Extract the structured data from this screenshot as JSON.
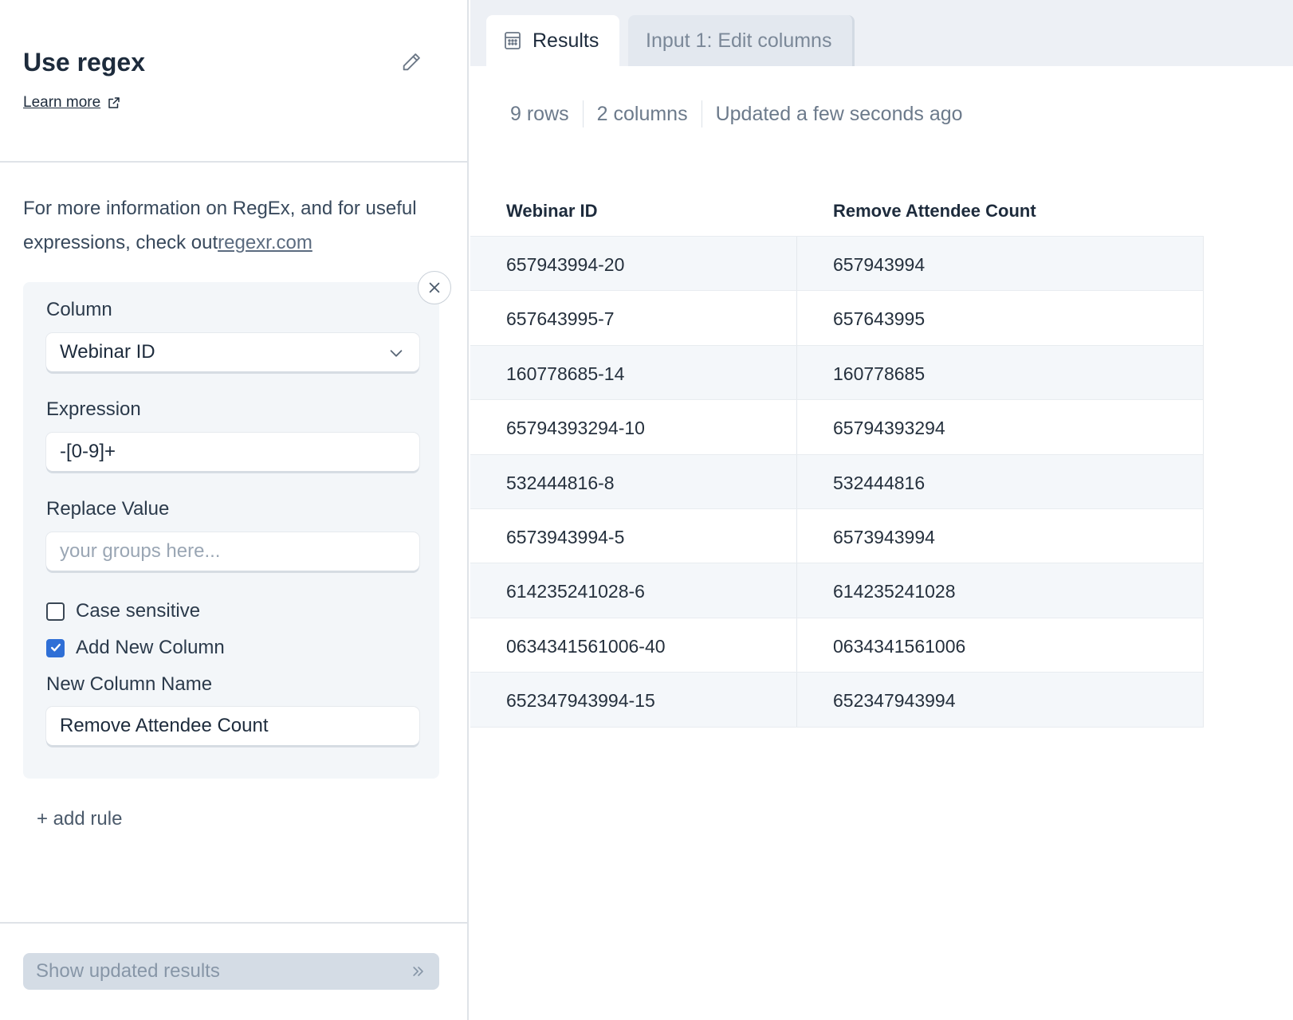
{
  "step": {
    "title": "Use regex",
    "learn_more": "Learn more",
    "info_prefix": "For more information on RegEx, and for useful expressions, check out",
    "info_link": "regexr.com"
  },
  "rule": {
    "column_label": "Column",
    "column_value": "Webinar ID",
    "expression_label": "Expression",
    "expression_value": "-[0-9]+",
    "replace_label": "Replace Value",
    "replace_placeholder": "your groups here...",
    "case_sensitive_label": "Case sensitive",
    "case_sensitive_checked": false,
    "add_new_column_label": "Add New Column",
    "add_new_column_checked": true,
    "new_column_name_label": "New Column Name",
    "new_column_name_value": "Remove Attendee Count"
  },
  "add_rule": "+ add rule",
  "show_results": "Show updated results",
  "tabs": [
    {
      "label": "Results",
      "icon": "calculator-icon",
      "active": true
    },
    {
      "label": "Input 1: Edit columns",
      "active": false
    }
  ],
  "meta": {
    "rows": "9 rows",
    "columns": "2 columns",
    "updated": "Updated a few seconds ago"
  },
  "table": {
    "headers": [
      "Webinar ID",
      "Remove Attendee Count"
    ],
    "rows": [
      [
        "657943994-20",
        "657943994"
      ],
      [
        "657643995-7",
        "657643995"
      ],
      [
        "160778685-14",
        "160778685"
      ],
      [
        "65794393294-10",
        "65794393294"
      ],
      [
        "532444816-8",
        "532444816"
      ],
      [
        "6573943994-5",
        "6573943994"
      ],
      [
        "614235241028-6",
        "614235241028"
      ],
      [
        "0634341561006-40",
        "0634341561006"
      ],
      [
        "652347943994-15",
        "652347943994"
      ]
    ]
  },
  "colors": {
    "accent": "#2f6fd6",
    "tabbar_bg": "#edf0f5",
    "row_alt": "#f4f7fa"
  }
}
